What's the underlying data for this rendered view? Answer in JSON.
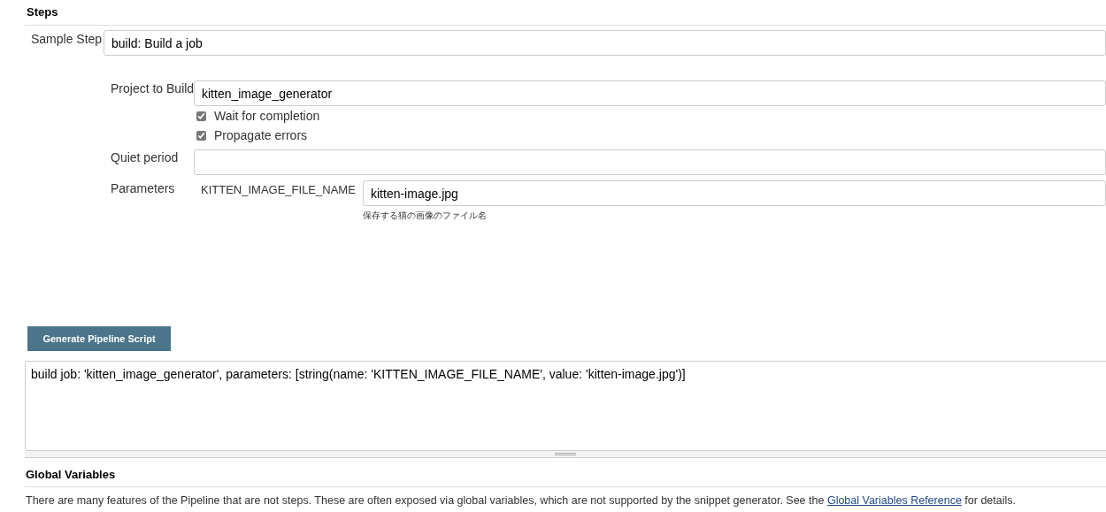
{
  "steps": {
    "heading": "Steps",
    "sample_step": {
      "label": "Sample Step",
      "value": "build: Build a job"
    },
    "project": {
      "label": "Project to Build",
      "value": "kitten_image_generator"
    },
    "checkboxes": [
      {
        "label": "Wait for completion",
        "checked": true
      },
      {
        "label": "Propagate errors",
        "checked": true
      }
    ],
    "quiet_period": {
      "label": "Quiet period"
    },
    "parameters": {
      "label": "Parameters",
      "name": "KITTEN_IMAGE_FILE_NAME",
      "value": "kitten-image.jpg",
      "help": "保存する猫の画像のファイル名"
    }
  },
  "generate_button": "Generate Pipeline Script",
  "script_output": "build job: 'kitten_image_generator', parameters: [string(name: 'KITTEN_IMAGE_FILE_NAME', value: 'kitten-image.jpg')]",
  "global_variables": {
    "heading": "Global Variables",
    "text_before": "There are many features of the Pipeline that are not steps. These are often exposed via global variables, which are not supported by the snippet generator. See the",
    "link": "Global Variables Reference",
    "text_after": "for details."
  }
}
